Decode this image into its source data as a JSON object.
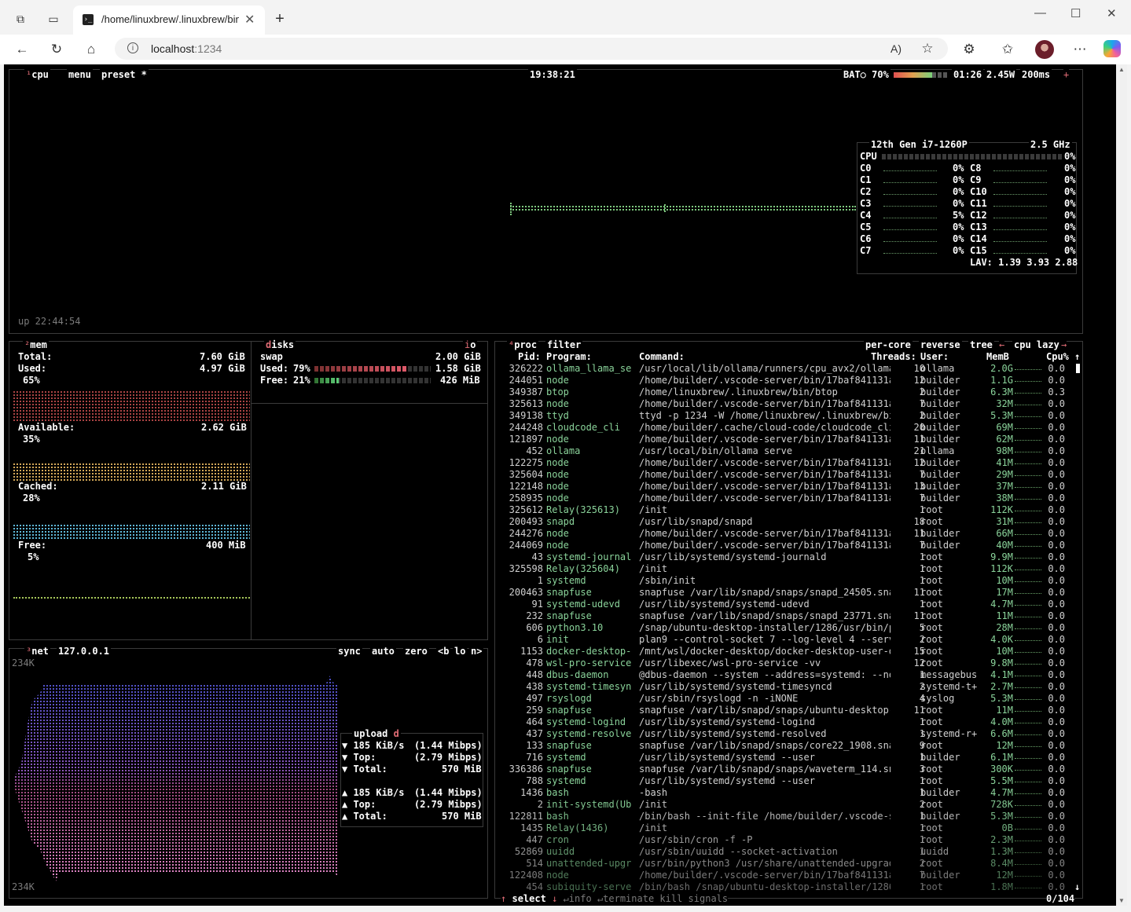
{
  "browser": {
    "tab_title": "/home/linuxbrew/.linuxbrew/bin/btop",
    "tab_icon": "terminal-icon",
    "address": {
      "host": "localhost",
      "port": ":1234"
    },
    "nav_icons": [
      "back-icon",
      "reload-icon",
      "home-icon",
      "info-icon"
    ],
    "toolbar_icons": [
      "read-aloud-icon",
      "favorite-star-icon",
      "extensions-icon",
      "favorites-icon",
      "profile-avatar",
      "more-icon",
      "copilot-icon"
    ],
    "window_controls": {
      "minimize": "—",
      "maximize": "☐",
      "close": "✕"
    }
  },
  "cpu_box": {
    "title_num": "¹",
    "title": "cpu",
    "menu": "menu",
    "preset": "preset *",
    "clock": "19:38:21",
    "battery": {
      "label": "BAT○ 70%",
      "level": 0.7,
      "time": "01:26",
      "power": "2.45W"
    },
    "interval": "200ms",
    "uptime": "up 22:44:54",
    "model": "12th Gen i7-1260P",
    "freq": "2.5 GHz",
    "total": {
      "label": "CPU",
      "pct": "0%"
    },
    "cores": [
      {
        "label": "C0",
        "pct": "0%"
      },
      {
        "label": "C1",
        "pct": "0%"
      },
      {
        "label": "C2",
        "pct": "0%"
      },
      {
        "label": "C3",
        "pct": "0%"
      },
      {
        "label": "C4",
        "pct": "5%"
      },
      {
        "label": "C5",
        "pct": "0%"
      },
      {
        "label": "C6",
        "pct": "0%"
      },
      {
        "label": "C7",
        "pct": "0%"
      },
      {
        "label": "C8",
        "pct": "0%"
      },
      {
        "label": "C9",
        "pct": "0%"
      },
      {
        "label": "C10",
        "pct": "0%"
      },
      {
        "label": "C11",
        "pct": "0%"
      },
      {
        "label": "C12",
        "pct": "0%"
      },
      {
        "label": "C13",
        "pct": "0%"
      },
      {
        "label": "C14",
        "pct": "0%"
      },
      {
        "label": "C15",
        "pct": "0%"
      }
    ],
    "lav": "LAV: 1.39 3.93 2.88"
  },
  "mem_box": {
    "title_num": "²",
    "title": "mem",
    "total_label": "Total:",
    "total": "7.60 GiB",
    "used_label": "Used:",
    "used": "4.97 GiB",
    "used_pct": "65%",
    "avail_label": "Available:",
    "avail": "2.62 GiB",
    "avail_pct": "35%",
    "cached_label": "Cached:",
    "cached": "2.11 GiB",
    "cached_pct": "28%",
    "free_label": "Free:",
    "free": "400 MiB",
    "free_pct": "5%"
  },
  "disks_box": {
    "title": "disks",
    "io": "io",
    "swap_label": "swap",
    "swap_total": "2.00 GiB",
    "used_label": "Used:",
    "used_pct": "79%",
    "used_val": "1.58 GiB",
    "used_level": 0.79,
    "free_label": "Free:",
    "free_pct": "21%",
    "free_val": "426 MiB",
    "free_level": 0.21
  },
  "net_box": {
    "title_num": "³",
    "title": "net",
    "iface": "127.0.0.1",
    "sync": "sync",
    "auto": "auto",
    "zero": "zero",
    "b": "<b",
    "lo": "lo",
    "n": "n>",
    "scale_top": "234K",
    "scale_bottom": "234K",
    "upload_title": "upload",
    "upload_key": "d",
    "down_rate": "185 KiB/s",
    "down_mbps": "(1.44 Mibps)",
    "down_top_label": "Top:",
    "down_top": "(2.79 Mibps)",
    "down_total_label": "Total:",
    "down_total": "570 MiB",
    "up_rate": "185 KiB/s",
    "up_mbps": "(1.44 Mibps)",
    "up_top_label": "Top:",
    "up_top": "(2.79 Mibps)",
    "up_total_label": "Total:",
    "up_total": "570 MiB"
  },
  "proc_box": {
    "title_num": "⁴",
    "title": "proc",
    "filter": "filter",
    "per_core": "per-core",
    "reverse": "reverse",
    "tree": "tree",
    "sort": "cpu lazy",
    "headers": {
      "pid": "Pid:",
      "program": "Program:",
      "command": "Command:",
      "threads": "Threads:",
      "user": "User:",
      "mem": "MemB",
      "cpu": "Cpu%"
    },
    "footer": {
      "select": "select",
      "info": "info",
      "terminate": "terminate",
      "kill": "kill",
      "signals": "signals",
      "count": "0/104"
    },
    "rows": [
      {
        "pid": "326222",
        "prog": "ollama_llama_se",
        "cmd": "/usr/local/lib/ollama/runners/cpu_avx2/ollama",
        "thr": "10",
        "user": "ollama",
        "mem": "2.0G",
        "cpu": "0.0"
      },
      {
        "pid": "244051",
        "prog": "node",
        "cmd": "/home/builder/.vscode-server/bin/17baf841131a",
        "thr": "12",
        "user": "builder",
        "mem": "1.1G",
        "cpu": "0.0"
      },
      {
        "pid": "349387",
        "prog": "btop",
        "cmd": "/home/linuxbrew/.linuxbrew/bin/btop",
        "thr": "2",
        "user": "builder",
        "mem": "6.3M",
        "cpu": "0.3"
      },
      {
        "pid": "325613",
        "prog": "node",
        "cmd": "/home/builder/.vscode-server/bin/17baf841131a",
        "thr": "7",
        "user": "builder",
        "mem": "32M",
        "cpu": "0.0"
      },
      {
        "pid": "349138",
        "prog": "ttyd",
        "cmd": "ttyd -p 1234 -W /home/linuxbrew/.linuxbrew/bi",
        "thr": "2",
        "user": "builder",
        "mem": "5.3M",
        "cpu": "0.0"
      },
      {
        "pid": "244248",
        "prog": "cloudcode_cli",
        "cmd": "/home/builder/.cache/cloud-code/cloudcode_cli",
        "thr": "20",
        "user": "builder",
        "mem": "69M",
        "cpu": "0.0"
      },
      {
        "pid": "121897",
        "prog": "node",
        "cmd": "/home/builder/.vscode-server/bin/17baf841131a",
        "thr": "11",
        "user": "builder",
        "mem": "62M",
        "cpu": "0.0"
      },
      {
        "pid": "452",
        "prog": "ollama",
        "cmd": "/usr/local/bin/ollama serve",
        "thr": "21",
        "user": "ollama",
        "mem": "98M",
        "cpu": "0.0"
      },
      {
        "pid": "122275",
        "prog": "node",
        "cmd": "/home/builder/.vscode-server/bin/17baf841131a",
        "thr": "12",
        "user": "builder",
        "mem": "41M",
        "cpu": "0.0"
      },
      {
        "pid": "325604",
        "prog": "node",
        "cmd": "/home/builder/.vscode-server/bin/17baf841131a",
        "thr": "7",
        "user": "builder",
        "mem": "29M",
        "cpu": "0.0"
      },
      {
        "pid": "122148",
        "prog": "node",
        "cmd": "/home/builder/.vscode-server/bin/17baf841131a",
        "thr": "13",
        "user": "builder",
        "mem": "37M",
        "cpu": "0.0"
      },
      {
        "pid": "258935",
        "prog": "node",
        "cmd": "/home/builder/.vscode-server/bin/17baf841131a",
        "thr": "7",
        "user": "builder",
        "mem": "38M",
        "cpu": "0.0"
      },
      {
        "pid": "325612",
        "prog": "Relay(325613)",
        "cmd": "/init",
        "thr": "1",
        "user": "root",
        "mem": "112K",
        "cpu": "0.0"
      },
      {
        "pid": "200493",
        "prog": "snapd",
        "cmd": "/usr/lib/snapd/snapd",
        "thr": "18",
        "user": "root",
        "mem": "31M",
        "cpu": "0.0"
      },
      {
        "pid": "244276",
        "prog": "node",
        "cmd": "/home/builder/.vscode-server/bin/17baf841131a",
        "thr": "11",
        "user": "builder",
        "mem": "66M",
        "cpu": "0.0"
      },
      {
        "pid": "244069",
        "prog": "node",
        "cmd": "/home/builder/.vscode-server/bin/17baf841131a",
        "thr": "7",
        "user": "builder",
        "mem": "40M",
        "cpu": "0.0"
      },
      {
        "pid": "43",
        "prog": "systemd-journal",
        "cmd": "/usr/lib/systemd/systemd-journald",
        "thr": "1",
        "user": "root",
        "mem": "9.9M",
        "cpu": "0.0"
      },
      {
        "pid": "325598",
        "prog": "Relay(325604)",
        "cmd": "/init",
        "thr": "1",
        "user": "root",
        "mem": "112K",
        "cpu": "0.0"
      },
      {
        "pid": "1",
        "prog": "systemd",
        "cmd": "/sbin/init",
        "thr": "1",
        "user": "root",
        "mem": "10M",
        "cpu": "0.0"
      },
      {
        "pid": "200463",
        "prog": "snapfuse",
        "cmd": "snapfuse /var/lib/snapd/snaps/snapd_24505.sna",
        "thr": "11",
        "user": "root",
        "mem": "17M",
        "cpu": "0.0"
      },
      {
        "pid": "91",
        "prog": "systemd-udevd",
        "cmd": "/usr/lib/systemd/systemd-udevd",
        "thr": "1",
        "user": "root",
        "mem": "4.7M",
        "cpu": "0.0"
      },
      {
        "pid": "232",
        "prog": "snapfuse",
        "cmd": "snapfuse /var/lib/snapd/snaps/snapd_23771.sna",
        "thr": "11",
        "user": "root",
        "mem": "11M",
        "cpu": "0.0"
      },
      {
        "pid": "606",
        "prog": "python3.10",
        "cmd": "/snap/ubuntu-desktop-installer/1286/usr/bin/p",
        "thr": "5",
        "user": "root",
        "mem": "28M",
        "cpu": "0.0"
      },
      {
        "pid": "6",
        "prog": "init",
        "cmd": "plan9 --control-socket 7 --log-level 4 --serv",
        "thr": "2",
        "user": "root",
        "mem": "4.0K",
        "cpu": "0.0"
      },
      {
        "pid": "1153",
        "prog": "docker-desktop-",
        "cmd": "/mnt/wsl/docker-desktop/docker-desktop-user-d",
        "thr": "15",
        "user": "root",
        "mem": "10M",
        "cpu": "0.0"
      },
      {
        "pid": "478",
        "prog": "wsl-pro-service",
        "cmd": "/usr/libexec/wsl-pro-service -vv",
        "thr": "12",
        "user": "root",
        "mem": "9.8M",
        "cpu": "0.0"
      },
      {
        "pid": "448",
        "prog": "dbus-daemon",
        "cmd": "@dbus-daemon --system --address=systemd: --no",
        "thr": "1",
        "user": "messagebus",
        "mem": "4.1M",
        "cpu": "0.0"
      },
      {
        "pid": "438",
        "prog": "systemd-timesyn",
        "cmd": "/usr/lib/systemd/systemd-timesyncd",
        "thr": "2",
        "user": "systemd-t+",
        "mem": "2.7M",
        "cpu": "0.0"
      },
      {
        "pid": "497",
        "prog": "rsyslogd",
        "cmd": "/usr/sbin/rsyslogd -n -iNONE",
        "thr": "4",
        "user": "syslog",
        "mem": "5.3M",
        "cpu": "0.0"
      },
      {
        "pid": "259",
        "prog": "snapfuse",
        "cmd": "snapfuse /var/lib/snapd/snaps/ubuntu-desktop-",
        "thr": "11",
        "user": "root",
        "mem": "11M",
        "cpu": "0.0"
      },
      {
        "pid": "464",
        "prog": "systemd-logind",
        "cmd": "/usr/lib/systemd/systemd-logind",
        "thr": "1",
        "user": "root",
        "mem": "4.0M",
        "cpu": "0.0"
      },
      {
        "pid": "437",
        "prog": "systemd-resolve",
        "cmd": "/usr/lib/systemd/systemd-resolved",
        "thr": "1",
        "user": "systemd-r+",
        "mem": "6.6M",
        "cpu": "0.0"
      },
      {
        "pid": "133",
        "prog": "snapfuse",
        "cmd": "snapfuse /var/lib/snapd/snaps/core22_1908.sna",
        "thr": "9",
        "user": "root",
        "mem": "12M",
        "cpu": "0.0"
      },
      {
        "pid": "716",
        "prog": "systemd",
        "cmd": "/usr/lib/systemd/systemd --user",
        "thr": "1",
        "user": "builder",
        "mem": "6.1M",
        "cpu": "0.0"
      },
      {
        "pid": "336386",
        "prog": "snapfuse",
        "cmd": "snapfuse /var/lib/snapd/snaps/waveterm_114.sn",
        "thr": "3",
        "user": "root",
        "mem": "300K",
        "cpu": "0.0"
      },
      {
        "pid": "788",
        "prog": "systemd",
        "cmd": "/usr/lib/systemd/systemd --user",
        "thr": "1",
        "user": "root",
        "mem": "5.5M",
        "cpu": "0.0"
      },
      {
        "pid": "1436",
        "prog": "bash",
        "cmd": "-bash",
        "thr": "1",
        "user": "builder",
        "mem": "4.7M",
        "cpu": "0.0"
      },
      {
        "pid": "2",
        "prog": "init-systemd(Ub",
        "cmd": "/init",
        "thr": "2",
        "user": "root",
        "mem": "728K",
        "cpu": "0.0"
      },
      {
        "pid": "122811",
        "prog": "bash",
        "cmd": "/bin/bash --init-file /home/builder/.vscode-s",
        "thr": "1",
        "user": "builder",
        "mem": "5.3M",
        "cpu": "0.0"
      },
      {
        "pid": "1435",
        "prog": "Relay(1436)",
        "cmd": "/init",
        "thr": "1",
        "user": "root",
        "mem": "0B",
        "cpu": "0.0"
      },
      {
        "pid": "447",
        "prog": "cron",
        "cmd": "/usr/sbin/cron -f -P",
        "thr": "1",
        "user": "root",
        "mem": "2.3M",
        "cpu": "0.0"
      },
      {
        "pid": "52869",
        "prog": "uuidd",
        "cmd": "/usr/sbin/uuidd --socket-activation",
        "thr": "1",
        "user": "uuidd",
        "mem": "1.3M",
        "cpu": "0.0"
      },
      {
        "pid": "514",
        "prog": "unattended-upgr",
        "cmd": "/usr/bin/python3 /usr/share/unattended-upgrad",
        "thr": "2",
        "user": "root",
        "mem": "8.4M",
        "cpu": "0.0"
      },
      {
        "pid": "122408",
        "prog": "node",
        "cmd": "/home/builder/.vscode-server/bin/17baf841131a",
        "thr": "7",
        "user": "builder",
        "mem": "12M",
        "cpu": "0.0"
      },
      {
        "pid": "454",
        "prog": "subiquity-serve",
        "cmd": "/bin/bash /snap/ubuntu-desktop-installer/1286",
        "thr": "1",
        "user": "root",
        "mem": "1.8M",
        "cpu": "0.0"
      }
    ]
  }
}
